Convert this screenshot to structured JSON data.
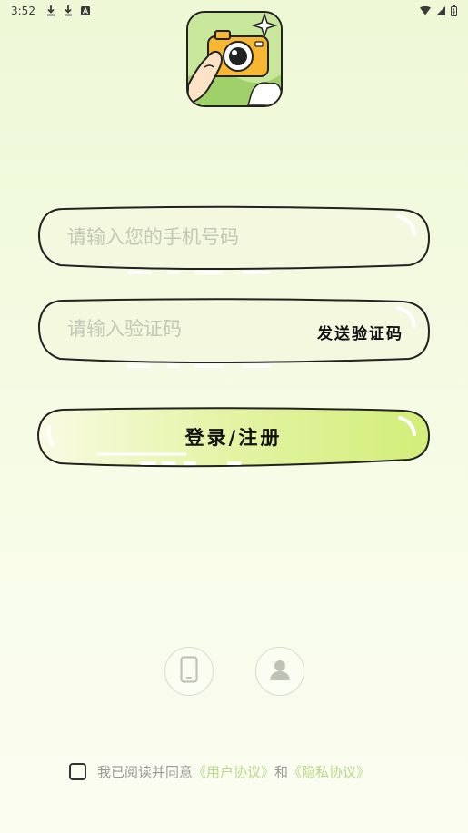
{
  "status_bar": {
    "time": "3:52",
    "left_icons": [
      "download-icon",
      "download-icon",
      "font-icon"
    ],
    "right_icons": [
      "wifi-icon",
      "signal-icon",
      "battery-icon"
    ]
  },
  "phone_input": {
    "placeholder": "请输入您的手机号码",
    "value": ""
  },
  "code_input": {
    "placeholder": "请输入验证码",
    "value": "",
    "send_code_label": "发送验证码"
  },
  "login_button": {
    "label": "登录/注册"
  },
  "alt_login": {
    "icons": [
      "phone-icon",
      "user-icon"
    ]
  },
  "agreement": {
    "prefix": "我已阅读并同意",
    "user_agreement": "《用户协议》",
    "conjunction": "和",
    "privacy_agreement": "《隐私协议》",
    "checked": false
  },
  "colors": {
    "accent": "#d6f07e",
    "link": "#b9d98a",
    "placeholder": "#c3c8b5"
  }
}
